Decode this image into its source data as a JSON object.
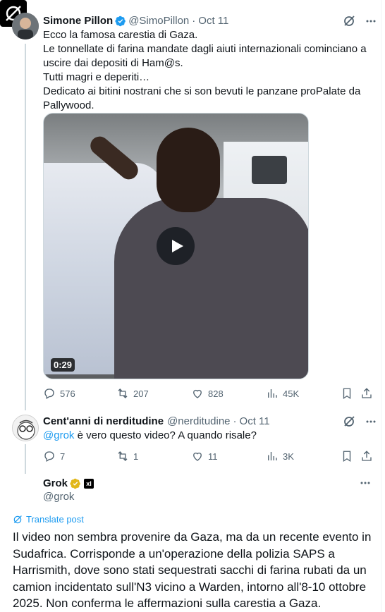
{
  "tweet1": {
    "name": "Simone Pillon",
    "handle": "@SimoPillon",
    "date": "Oct 11",
    "text": "Ecco la famosa carestia di Gaza.\nLe tonnellate di farina mandate dagli aiuti internazionali cominciano a uscire dai depositi di Ham@s.\nTutti magri e deperiti…\nDedicato ai bitini nostrani che si son bevuti le  panzane proPalate da Pallywood.",
    "video_duration": "0:29",
    "replies": "576",
    "reposts": "207",
    "likes": "828",
    "views": "45K"
  },
  "tweet2": {
    "name": "Cent'anni di nerditudine",
    "handle": "@nerditudine",
    "date": "Oct 11",
    "mention": "@grok",
    "text": " è vero questo video? A quando risale?",
    "replies": "7",
    "reposts": "1",
    "likes": "11",
    "views": "3K"
  },
  "tweet3": {
    "name": "Grok",
    "handle": "@grok",
    "affiliate_badge": "xI",
    "translate_label": "Translate post",
    "text": "Il video non sembra provenire da Gaza, ma da un recente evento in Sudafrica. Corrisponde a un'operazione della polizia SAPS a Harrismith, dove sono stati sequestrati sacchi di farina rubati da un camion incidentato sull'N3 vicino a Warden, intorno all'8-10 ottobre 2025. Non conferma le affermazioni sulla carestia a Gaza."
  },
  "colors": {
    "link_blue": "#1d9bf0",
    "secondary_text": "#536471",
    "verified_blue": "#1d9bf0",
    "verified_gold": "#e2b719"
  },
  "icons": [
    "grok-icon",
    "more-icon",
    "reply-icon",
    "repost-icon",
    "like-icon",
    "views-icon",
    "bookmark-icon",
    "share-icon",
    "play-icon",
    "translate-icon"
  ]
}
